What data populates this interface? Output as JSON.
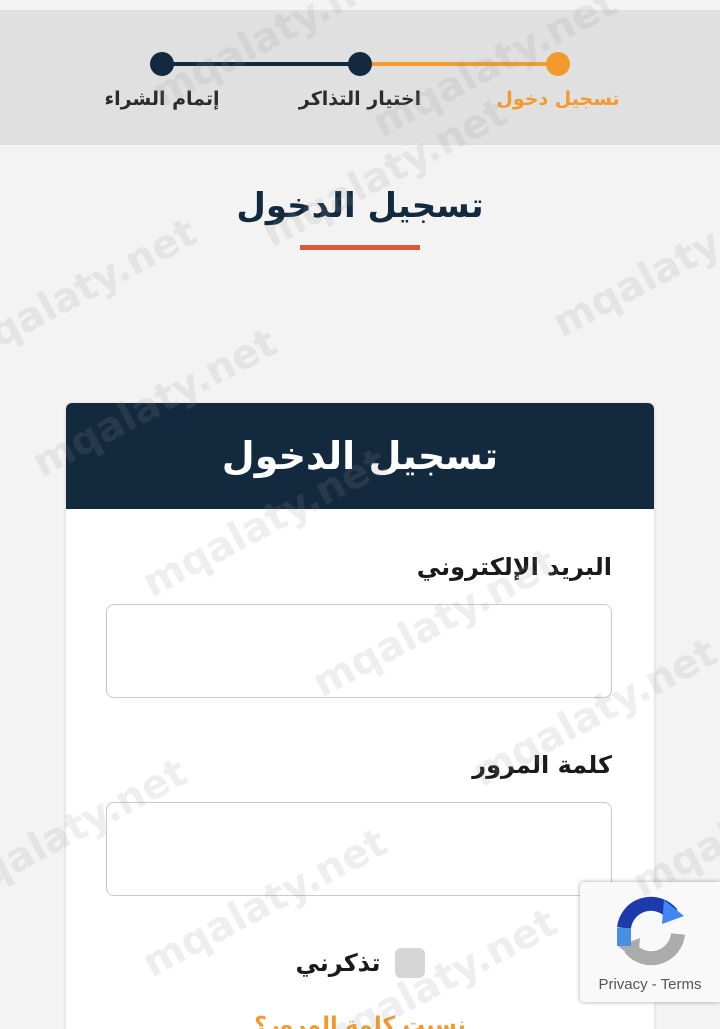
{
  "stepper": {
    "steps": [
      {
        "label": "تسجيل دخول",
        "state": "active"
      },
      {
        "label": "اختيار التذاكر",
        "state": "pending"
      },
      {
        "label": "إتمام الشراء",
        "state": "pending"
      }
    ]
  },
  "header": {
    "title": "تسجيل الدخول"
  },
  "login_card": {
    "title": "تسجيل الدخول",
    "email_label": "البريد الإلكتروني",
    "email_value": "",
    "password_label": "كلمة المرور",
    "password_value": "",
    "remember_label": "تذكرني",
    "forgot_link": "نسيت كلمة المرور؟"
  },
  "recaptcha": {
    "text": "Privacy - Terms"
  },
  "watermark": "mqalaty.net",
  "colors": {
    "navy": "#13293d",
    "orange": "#f39a2d",
    "underline_red": "#d9593a",
    "background": "#f3f3f3",
    "stepper_bg": "#e0e0e0"
  },
  "icons": {
    "recaptcha": "recaptcha-logo-icon"
  }
}
